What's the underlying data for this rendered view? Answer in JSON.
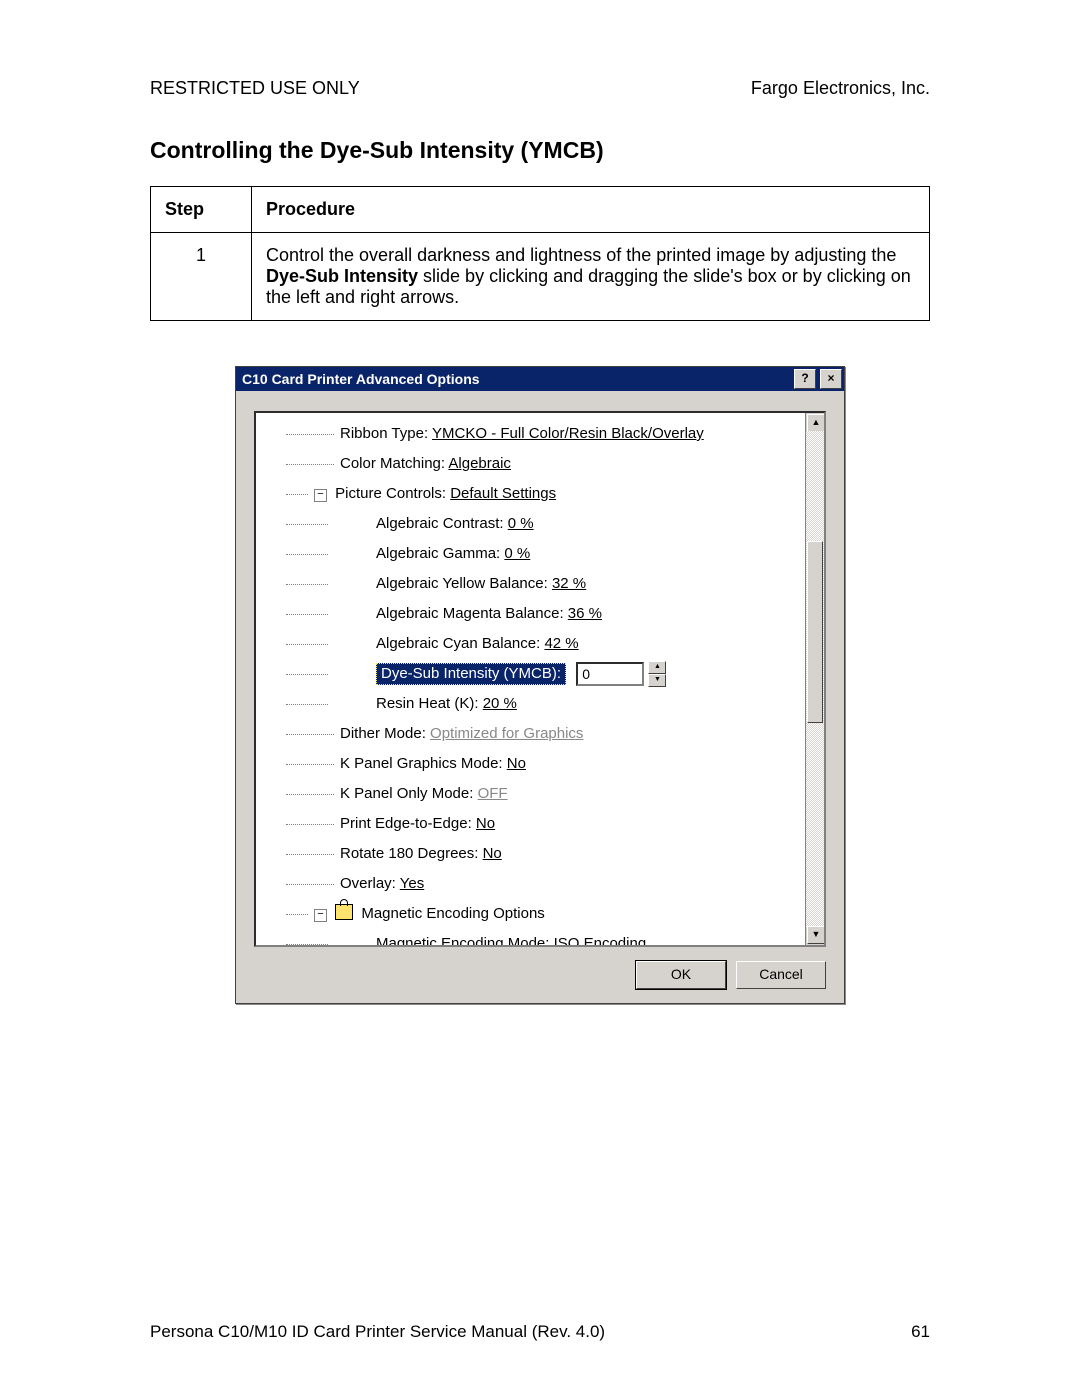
{
  "header": {
    "left": "RESTRICTED USE ONLY",
    "right": "Fargo Electronics, Inc."
  },
  "section_title": "Controlling the Dye-Sub Intensity (YMCB)",
  "table": {
    "col_step": "Step",
    "col_proc": "Procedure",
    "rows": [
      {
        "step": "1",
        "proc_pre": "Control the overall darkness and lightness of the printed image by adjusting the ",
        "proc_bold": "Dye-Sub Intensity",
        "proc_post": " slide by clicking and dragging the slide's box or by clicking on the left and right arrows."
      }
    ]
  },
  "dialog": {
    "title": "C10 Card Printer Advanced Options",
    "help_glyph": "?",
    "close_glyph": "×",
    "tree": {
      "ribbon_label": "Ribbon Type: ",
      "ribbon_value": "YMCKO - Full Color/Resin Black/Overlay",
      "color_label": "Color Matching: ",
      "color_value": "Algebraic",
      "pic_label": "Picture Controls: ",
      "pic_value": "Default Settings",
      "alg_contrast_label": "Algebraic Contrast: ",
      "alg_contrast_value": "0 %",
      "alg_gamma_label": "Algebraic Gamma: ",
      "alg_gamma_value": "0 %",
      "alg_yellow_label": "Algebraic Yellow Balance: ",
      "alg_yellow_value": "32 %",
      "alg_magenta_label": "Algebraic Magenta Balance: ",
      "alg_magenta_value": "36 %",
      "alg_cyan_label": "Algebraic Cyan Balance: ",
      "alg_cyan_value": "42 %",
      "dyesub_label": "Dye-Sub Intensity (YMCB):",
      "dyesub_value": "0",
      "resin_label": "Resin Heat (K): ",
      "resin_value": "20 %",
      "dither_label": "Dither Mode: ",
      "dither_value": "Optimized for Graphics",
      "kpanel_gfx_label": "K Panel Graphics Mode: ",
      "kpanel_gfx_value": "No",
      "kpanel_only_label": "K Panel Only Mode: ",
      "kpanel_only_value": "OFF",
      "edge_label": "Print Edge-to-Edge: ",
      "edge_value": "No",
      "rotate_label": "Rotate 180 Degrees: ",
      "rotate_value": "No",
      "overlay_label": "Overlay: ",
      "overlay_value": "Yes",
      "mag_opts_label": "Magnetic Encoding Options",
      "mag_mode_label": "Magnetic Encoding Mode: ",
      "mag_mode_value": "ISO Encoding"
    },
    "buttons": {
      "ok": "OK",
      "cancel": "Cancel"
    }
  },
  "footer": {
    "left": "Persona C10/M10 ID Card Printer Service Manual (Rev. 4.0)",
    "right": "61"
  }
}
